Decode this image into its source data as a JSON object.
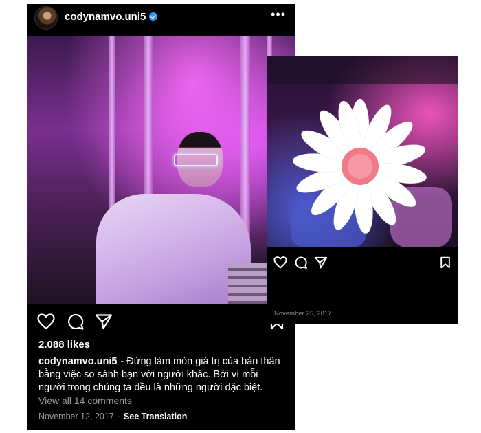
{
  "post_left": {
    "username": "codynamvo.uni5",
    "likes": "2.088 likes",
    "caption_user": "codynamvo.uni5",
    "caption_text": "- Đừng làm mòn giá trị của bản thân bằng việc so sánh bạn với người khác. Bởi vì mỗi người trong chúng ta đều là những người đặc biệt.",
    "view_comments": "View all 14 comments",
    "date": "November 12, 2017",
    "separator": "·",
    "see_translation": "See Translation",
    "icons": [
      "heart-icon",
      "comment-icon",
      "share-icon",
      "bookmark-icon",
      "more-options-icon",
      "verified-badge-icon"
    ]
  },
  "post_right": {
    "date": "November 25, 2017",
    "icons": [
      "heart-icon",
      "comment-icon",
      "share-icon",
      "bookmark-icon"
    ]
  },
  "colors": {
    "background": "#000000",
    "text": "#ffffff",
    "muted": "#9a9a9a",
    "verified": "#3897f0"
  }
}
